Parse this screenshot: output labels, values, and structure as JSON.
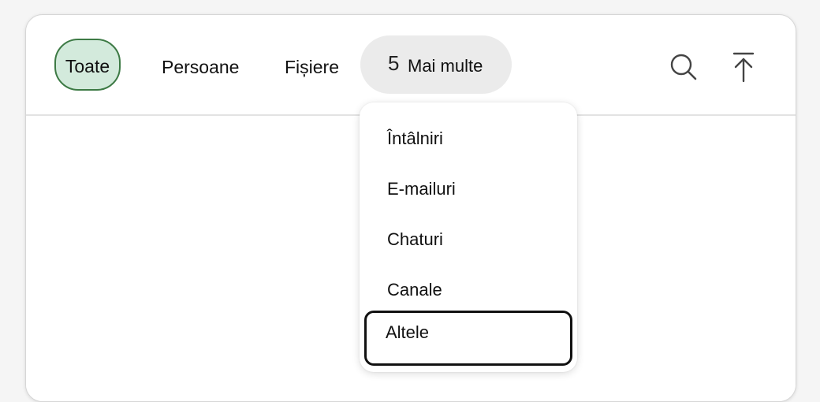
{
  "toolbar": {
    "tabs": {
      "all": "Toate",
      "people": "Persoane",
      "files": "Fișiere",
      "more_count": "5",
      "more_label": "Mai multe"
    },
    "icons": {
      "search": "search-icon",
      "scroll_top": "arrow-up-to-top-icon"
    }
  },
  "dropdown": {
    "items": [
      "Întâlniri",
      "E-mailuri",
      "Chaturi",
      "Canale",
      "Altele"
    ],
    "focused_index": 4
  },
  "colors": {
    "active_tab_fill": "#d3eadc",
    "active_tab_border": "#3d7a45",
    "more_tab_fill": "#ebebeb",
    "focus_ring": "#111111"
  }
}
